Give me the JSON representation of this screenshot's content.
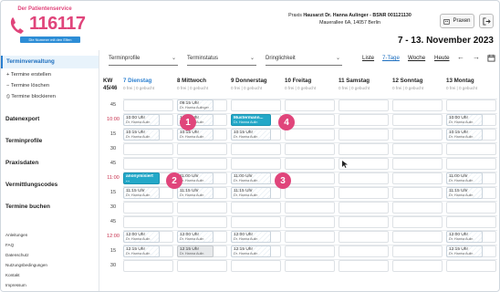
{
  "logo": {
    "tagline": "Der Patientenservice",
    "number": "116117",
    "slogan": "Die Nummer mit den Elfen"
  },
  "header": {
    "practice_prefix": "Praxis",
    "practice_name": "Hausarzt Dr. Hanna Aulinger",
    "bsnr": "- BSNR 001121130",
    "address": "Mauerallee 6A, 14057 Berlin",
    "praxen_label": "Praxen",
    "date_range": "7 - 13. November 2023"
  },
  "sidebar": {
    "active": "Terminverwaltung",
    "sub_items": [
      "+ Termine erstellen",
      "− Termine löschen",
      "⦸ Termine blockieren"
    ],
    "sections": [
      "Datenexport",
      "Terminprofile",
      "Praxisdaten",
      "Vermittlungscodes",
      "Termine buchen"
    ],
    "footer_links": [
      "Anleitungen",
      "FAQ",
      "Datenschutz",
      "Nutzungsbedingungen",
      "Kontakt",
      "Impressum"
    ]
  },
  "filters": {
    "profile": "Terminprofile",
    "status": "Terminstatus",
    "urgency": "Dringlichkeit"
  },
  "views": {
    "liste": "Liste",
    "seven_days": "7-Tage",
    "woche": "Woche",
    "heute": "Heute"
  },
  "calendar": {
    "kw_label": "KW",
    "kw_value": "45/46",
    "days": [
      {
        "name": "7 Dienstag",
        "free": "0 frei | 0 gebucht"
      },
      {
        "name": "8 Mittwoch",
        "free": "0 frei | 0 gebucht"
      },
      {
        "name": "9 Donnerstag",
        "free": "0 frei | 0 gebucht"
      },
      {
        "name": "10 Freitag",
        "free": "0 frei | 0 gebucht"
      },
      {
        "name": "11 Samstag",
        "free": "0 frei | 0 gebucht"
      },
      {
        "name": "12 Sonntag",
        "free": "0 frei | 0 gebucht"
      },
      {
        "name": "13 Montag",
        "free": "0 frei | 0 gebucht"
      }
    ],
    "times": [
      "45",
      "10:00",
      "15",
      "30",
      "45",
      "11:00",
      "15",
      "30",
      "45",
      "12:00",
      "15",
      "30"
    ],
    "appointments": [
      {
        "time": "09:15 Uhr",
        "doc": "Dr. Hanna Aulinger"
      },
      {
        "time": "10:00 Uhr",
        "doc": "Dr. Hanna Aulin"
      },
      {
        "time": "10:00 Uhr",
        "doc": "Dr. Hanna Aulin"
      },
      {
        "time": "Mustermann...",
        "doc": "Dr. Hanna Aulin"
      },
      {
        "time": "10:00 Uhr",
        "doc": "Dr. Hanna Aulin"
      },
      {
        "time": "10:15 Uhr",
        "doc": "Dr. Hanna Aulin"
      },
      {
        "time": "10:15 Uhr",
        "doc": "Dr. Hanna Aulin"
      },
      {
        "time": "10:15 Uhr",
        "doc": "Dr. Hanna Aulin"
      },
      {
        "time": "10:15 Uhr",
        "doc": "Dr. Hanna Aulin"
      },
      {
        "time": "anonymisiert ...",
        "doc": "Dr. Hanna Aulin"
      },
      {
        "time": "11:00 Uhr",
        "doc": "Dr. Hanna Aulin"
      },
      {
        "time": "11:00 Uhr",
        "doc": "Dr. Hanna Aulin"
      },
      {
        "time": "11:00 Uhr",
        "doc": "Dr. Hanna Aulin"
      },
      {
        "time": "11:15 Uhr",
        "doc": "Dr. Hanna Aulin"
      },
      {
        "time": "11:15 Uhr",
        "doc": "Dr. Hanna Aulin"
      },
      {
        "time": "11:15 Uhr",
        "doc": "Dr. Hanna Aulin"
      },
      {
        "time": "11:15 Uhr",
        "doc": "Dr. Hanna Aulin"
      },
      {
        "time": "12:00 Uhr",
        "doc": "Dr. Hanna Aulin"
      },
      {
        "time": "12:00 Uhr",
        "doc": "Dr. Hanna Aulin"
      },
      {
        "time": "12:00 Uhr",
        "doc": "Dr. Hanna Aulin"
      },
      {
        "time": "12:00 Uhr",
        "doc": "Dr. Hanna Aulin"
      },
      {
        "time": "12:15 Uhr",
        "doc": "Dr. Hanna Aulin"
      },
      {
        "time": "12:15 Uhr",
        "doc": "Dr. Hanna Aulin"
      },
      {
        "time": "12:15 Uhr",
        "doc": "Dr. Hanna Aulin"
      },
      {
        "time": "12:15 Uhr",
        "doc": "Dr. Hanna Aulin"
      }
    ],
    "markers": [
      "1",
      "2",
      "3",
      "4"
    ]
  },
  "colors": {
    "accent": "#2a7fd0",
    "brand_pink": "#e0457b",
    "teal": "#23a8c8",
    "hour_red": "#c8324f"
  }
}
